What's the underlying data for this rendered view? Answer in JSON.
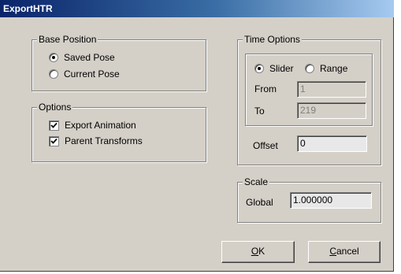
{
  "window": {
    "title": "ExportHTR"
  },
  "base_position": {
    "legend": "Base Position",
    "options": [
      {
        "label": "Saved Pose",
        "checked": true
      },
      {
        "label": "Current Pose",
        "checked": false
      }
    ]
  },
  "options_group": {
    "legend": "Options",
    "items": [
      {
        "label": "Export Animation",
        "checked": true
      },
      {
        "label": "Parent Transforms",
        "checked": true
      }
    ]
  },
  "time_options": {
    "legend": "Time Options",
    "slider_label": "Slider",
    "slider_checked": true,
    "range_label": "Range",
    "range_checked": false,
    "from_label": "From",
    "from_value": "1",
    "to_label": "To",
    "to_value": "219",
    "offset_label": "Offset",
    "offset_value": "0"
  },
  "scale": {
    "legend": "Scale",
    "global_label": "Global",
    "global_value": "1.000000"
  },
  "buttons": {
    "ok_mnemonic": "O",
    "ok_rest": "K",
    "cancel_mnemonic": "C",
    "cancel_rest": "ancel"
  }
}
